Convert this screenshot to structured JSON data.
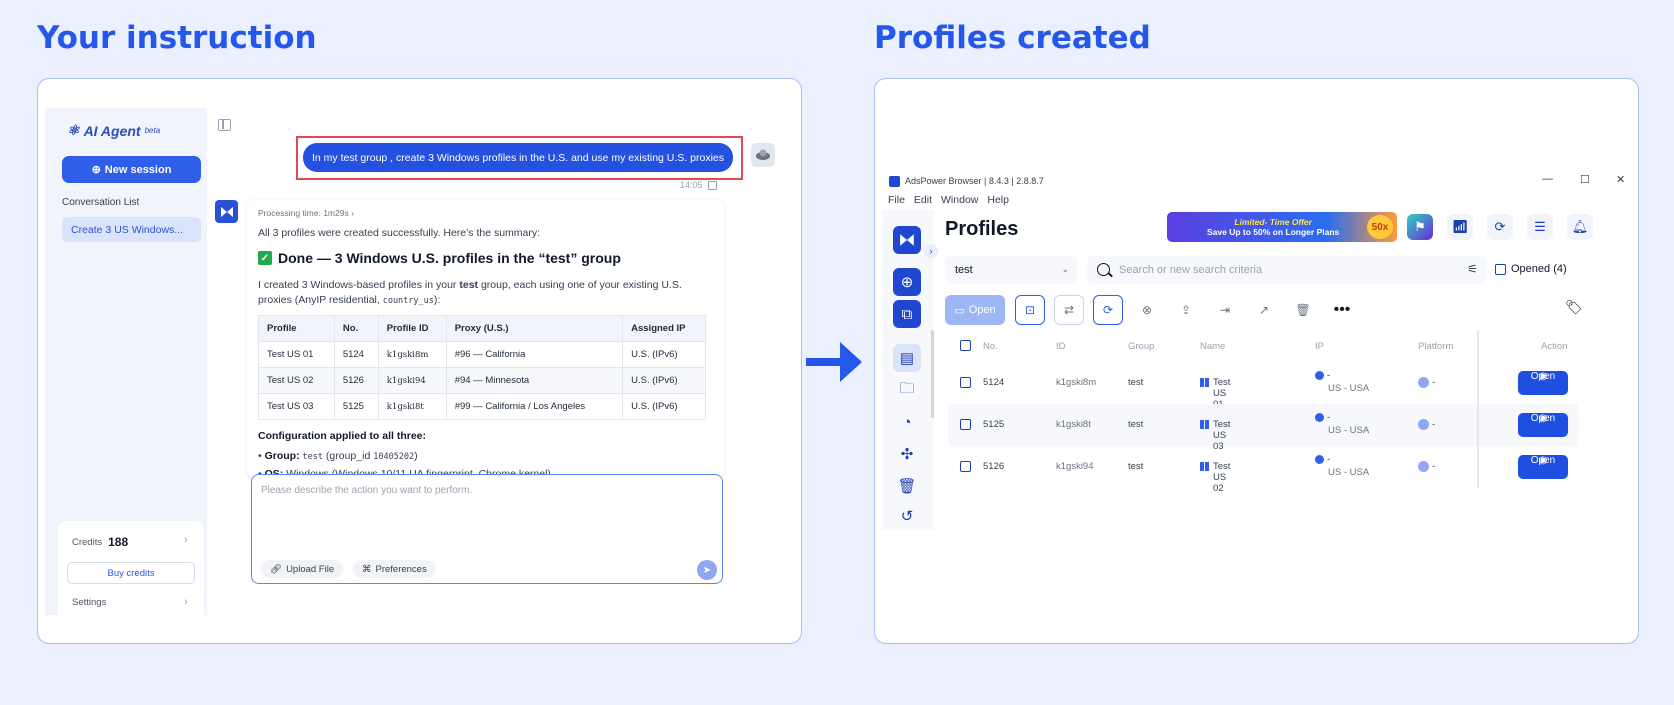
{
  "headings": {
    "left": "Your instruction",
    "right": "Profiles created"
  },
  "colors": {
    "accent": "#2557e8",
    "highlight_box": "#e5484d",
    "open_button": "#1f4fe0"
  },
  "agent": {
    "brand": "AI Agent",
    "brand_tag": "beta",
    "new_session": "New session",
    "conversation_list_title": "Conversation List",
    "conversation_item": "Create 3 US Windows...",
    "credits_label": "Credits",
    "credits_value": "188",
    "buy_credits": "Buy credits",
    "settings": "Settings",
    "user_message": "In my test group , create 3 Windows profiles in the U.S. and use my existing U.S. proxies",
    "message_time": "14:05",
    "processing": "Processing time: 1m29s",
    "summary_intro": "All 3 profiles were created successfully. Here’s the summary:",
    "done_title": "Done — 3 Windows U.S. profiles in the “test” group",
    "para_1": "I created 3 Windows-based profiles in your",
    "para_group": "test",
    "para_2": "group, each using one of your existing U.S. proxies (AnyIP residential,",
    "para_code": "country_us",
    "para_3": "):",
    "table_headers": [
      "Profile",
      "No.",
      "Profile ID",
      "Proxy (U.S.)",
      "Assigned IP"
    ],
    "table_rows": [
      [
        "Test US 01",
        "5124",
        "k1gski8m",
        "#96 — California",
        "U.S. (IPv6)"
      ],
      [
        "Test US 02",
        "5126",
        "k1gski94",
        "#94 — Minnesota",
        "U.S. (IPv6)"
      ],
      [
        "Test US 03",
        "5125",
        "k1gski8t",
        "#99 — California / Los Angeles",
        "U.S. (IPv6)"
      ]
    ],
    "config_title": "Configuration applied to all three:",
    "bullet_group_label": "Group:",
    "bullet_group_code": "test",
    "bullet_group_rest": "(group_id",
    "bullet_group_id": "10405202",
    "bullet_group_close": ")",
    "bullet_os_label": "OS:",
    "bullet_os_value": "Windows (Windows 10/11 UA fingerprint, Chrome kernel)",
    "input_placeholder": "Please describe the action you want to perform.",
    "upload_file": "Upload File",
    "preferences": "Preferences"
  },
  "adspower": {
    "window_title": "AdsPower Browser | 8.4.3 | 2.8.8.7",
    "menu": [
      "File",
      "Edit",
      "Window",
      "Help"
    ],
    "page_title": "Profiles",
    "banner_line1_a": "Limited",
    "banner_line1_b": "- Time Offer",
    "banner_line2": "Save Up to 50% on Longer Plans",
    "banner_badge": "50x",
    "group_select": "test",
    "search_placeholder": "Search or new search criteria",
    "opened_label": "Opened (4)",
    "open_button": "Open",
    "columns": [
      "No.",
      "ID",
      "Group",
      "Name",
      "IP",
      "Platform",
      "Action"
    ],
    "rows": [
      {
        "no": "5124",
        "id": "k1gski8m",
        "group": "test",
        "name": "Test US 01",
        "ip_top": "-",
        "ip_bottom": "US - USA",
        "platform": "-",
        "action": "Open"
      },
      {
        "no": "5125",
        "id": "k1gski8t",
        "group": "test",
        "name": "Test US 03",
        "ip_top": "-",
        "ip_bottom": "US - USA",
        "platform": "-",
        "action": "Open"
      },
      {
        "no": "5126",
        "id": "k1gski94",
        "group": "test",
        "name": "Test US 02",
        "ip_top": "-",
        "ip_bottom": "US - USA",
        "platform": "-",
        "action": "Open"
      }
    ]
  }
}
